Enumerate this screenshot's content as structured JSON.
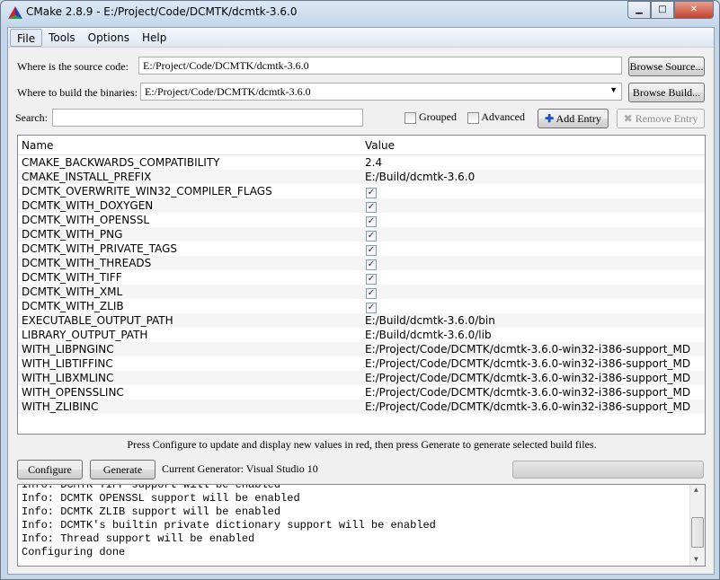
{
  "window": {
    "title": "CMake 2.8.9 - E:/Project/Code/DCMTK/dcmtk-3.6.0"
  },
  "menu": [
    "File",
    "Tools",
    "Options",
    "Help"
  ],
  "source": {
    "label": "Where is the source code:",
    "value": "E:/Project/Code/DCMTK/dcmtk-3.6.0",
    "browse": "Browse Source..."
  },
  "build": {
    "label": "Where to build the binaries:",
    "value": "E:/Project/Code/DCMTK/dcmtk-3.6.0",
    "browse": "Browse Build..."
  },
  "search": {
    "label": "Search:",
    "value": ""
  },
  "options": {
    "grouped": "Grouped",
    "grouped_checked": false,
    "advanced": "Advanced",
    "advanced_checked": false,
    "add_entry": "Add Entry",
    "remove_entry": "Remove Entry"
  },
  "table": {
    "headers": [
      "Name",
      "Value"
    ],
    "rows": [
      {
        "name": "CMAKE_BACKWARDS_COMPATIBILITY",
        "value": "2.4"
      },
      {
        "name": "CMAKE_INSTALL_PREFIX",
        "value": "E:/Build/dcmtk-3.6.0"
      },
      {
        "name": "DCMTK_OVERWRITE_WIN32_COMPILER_FLAGS",
        "checked": true
      },
      {
        "name": "DCMTK_WITH_DOXYGEN",
        "checked": true
      },
      {
        "name": "DCMTK_WITH_OPENSSL",
        "checked": true
      },
      {
        "name": "DCMTK_WITH_PNG",
        "checked": true
      },
      {
        "name": "DCMTK_WITH_PRIVATE_TAGS",
        "checked": true
      },
      {
        "name": "DCMTK_WITH_THREADS",
        "checked": true
      },
      {
        "name": "DCMTK_WITH_TIFF",
        "checked": true
      },
      {
        "name": "DCMTK_WITH_XML",
        "checked": true
      },
      {
        "name": "DCMTK_WITH_ZLIB",
        "checked": true
      },
      {
        "name": "EXECUTABLE_OUTPUT_PATH",
        "value": "E:/Build/dcmtk-3.6.0/bin"
      },
      {
        "name": "LIBRARY_OUTPUT_PATH",
        "value": "E:/Build/dcmtk-3.6.0/lib"
      },
      {
        "name": "WITH_LIBPNGINC",
        "value": "E:/Project/Code/DCMTK/dcmtk-3.6.0-win32-i386-support_MD"
      },
      {
        "name": "WITH_LIBTIFFINC",
        "value": "E:/Project/Code/DCMTK/dcmtk-3.6.0-win32-i386-support_MD"
      },
      {
        "name": "WITH_LIBXMLINC",
        "value": "E:/Project/Code/DCMTK/dcmtk-3.6.0-win32-i386-support_MD"
      },
      {
        "name": "WITH_OPENSSLINC",
        "value": "E:/Project/Code/DCMTK/dcmtk-3.6.0-win32-i386-support_MD"
      },
      {
        "name": "WITH_ZLIBINC",
        "value": "E:/Project/Code/DCMTK/dcmtk-3.6.0-win32-i386-support_MD"
      }
    ]
  },
  "hint": "Press Configure to update and display new values in red, then press Generate to generate selected build files.",
  "actions": {
    "configure": "Configure",
    "generate": "Generate",
    "generator": "Current Generator: Visual Studio 10"
  },
  "progress": 0,
  "log": [
    "Info: DCMTK TIFF support will be enabled",
    "Info: DCMTK OPENSSL support will be enabled",
    "Info: DCMTK ZLIB support will be enabled",
    "Info: DCMTK's builtin private dictionary support will be enabled",
    "Info: Thread support will be enabled",
    "Configuring done"
  ]
}
